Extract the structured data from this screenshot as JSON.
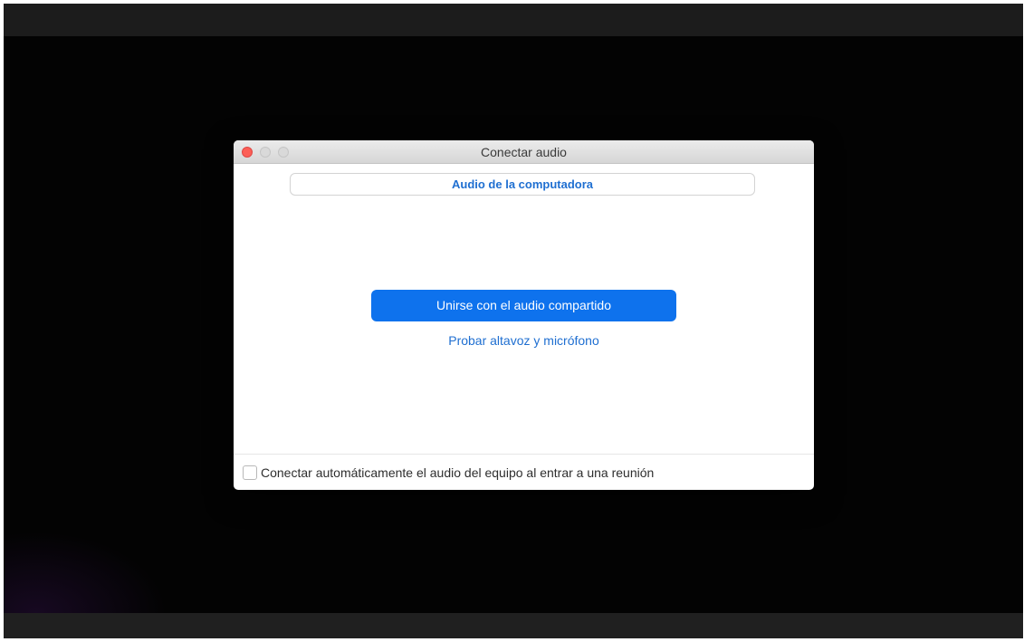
{
  "dialog": {
    "title": "Conectar audio",
    "tabs": [
      {
        "label": "Audio de la computadora",
        "selected": true
      }
    ],
    "join_button_label": "Unirse con el audio compartido",
    "test_link_label": "Probar altavoz y micrófono",
    "auto_connect": {
      "label": "Conectar automáticamente el audio del equipo al entrar a una reunión",
      "checked": false
    }
  },
  "icons": {
    "close": "close-traffic-light-icon",
    "minimize": "minimize-traffic-light-icon",
    "maximize": "maximize-traffic-light-icon"
  },
  "colors": {
    "accent": "#0e72ed",
    "link": "#1f6fd1",
    "close_light": "#fc5f57",
    "background": "#030303"
  }
}
